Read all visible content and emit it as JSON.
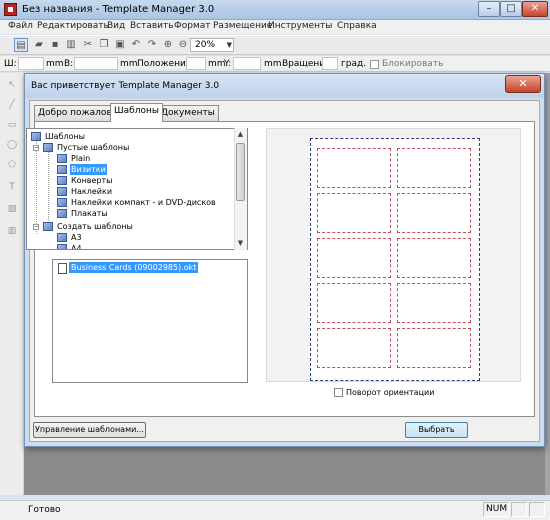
{
  "window": {
    "title": "Без названия - Template Manager 3.0",
    "minimize": "–",
    "maximize": "□",
    "close": "✕"
  },
  "menu": [
    "Файл",
    "Редактировать",
    "Вид",
    "Вставить",
    "Формат",
    "Размещение",
    "Инструменты",
    "Справка"
  ],
  "toolbar": {
    "zoom": "20%"
  },
  "propbar": {
    "width_label": "Ш:",
    "unit1": "mm",
    "height_label": "В:",
    "unit2": "mm",
    "posx_label": "Положение X:",
    "unit3": "mm",
    "posy_label": "Y:",
    "unit4": "mm",
    "rotation_label": "Вращение",
    "deg": "град.",
    "lock_label": "Блокировать"
  },
  "dialog": {
    "title": "Вас приветствует Template Manager 3.0",
    "close": "✕",
    "tabs": [
      "Добро пожаловать",
      "Шаблоны",
      "Документы"
    ],
    "active_tab": "Шаблоны",
    "tree": [
      {
        "label": "Шаблоны",
        "level": 0,
        "type": "folder"
      },
      {
        "label": "Пустые шаблоны",
        "level": 1,
        "type": "folder"
      },
      {
        "label": "Plain",
        "level": 2,
        "type": "doc"
      },
      {
        "label": "Визитки",
        "level": 2,
        "type": "doc",
        "selected": true
      },
      {
        "label": "Конверты",
        "level": 2,
        "type": "doc"
      },
      {
        "label": "Наклейки",
        "level": 2,
        "type": "doc"
      },
      {
        "label": "Наклейки компакт - и DVD-дисков",
        "level": 2,
        "type": "doc"
      },
      {
        "label": "Плакаты",
        "level": 2,
        "type": "doc"
      },
      {
        "label": "Создать шаблоны",
        "level": 1,
        "type": "folder"
      },
      {
        "label": "A3",
        "level": 2,
        "type": "doc"
      },
      {
        "label": "A4",
        "level": 2,
        "type": "doc"
      }
    ],
    "file": "Business Cards (09002985).okt",
    "orientation_label": "Поворот ориентации",
    "manage_button": "Управление шаблонами...",
    "choose_button": "Выбрать"
  },
  "status": {
    "text": "Готово",
    "num": "NUM"
  },
  "colors": {
    "selection": "#3399ff",
    "card_border": "#c4505a",
    "page_border": "#2a3c8a"
  }
}
